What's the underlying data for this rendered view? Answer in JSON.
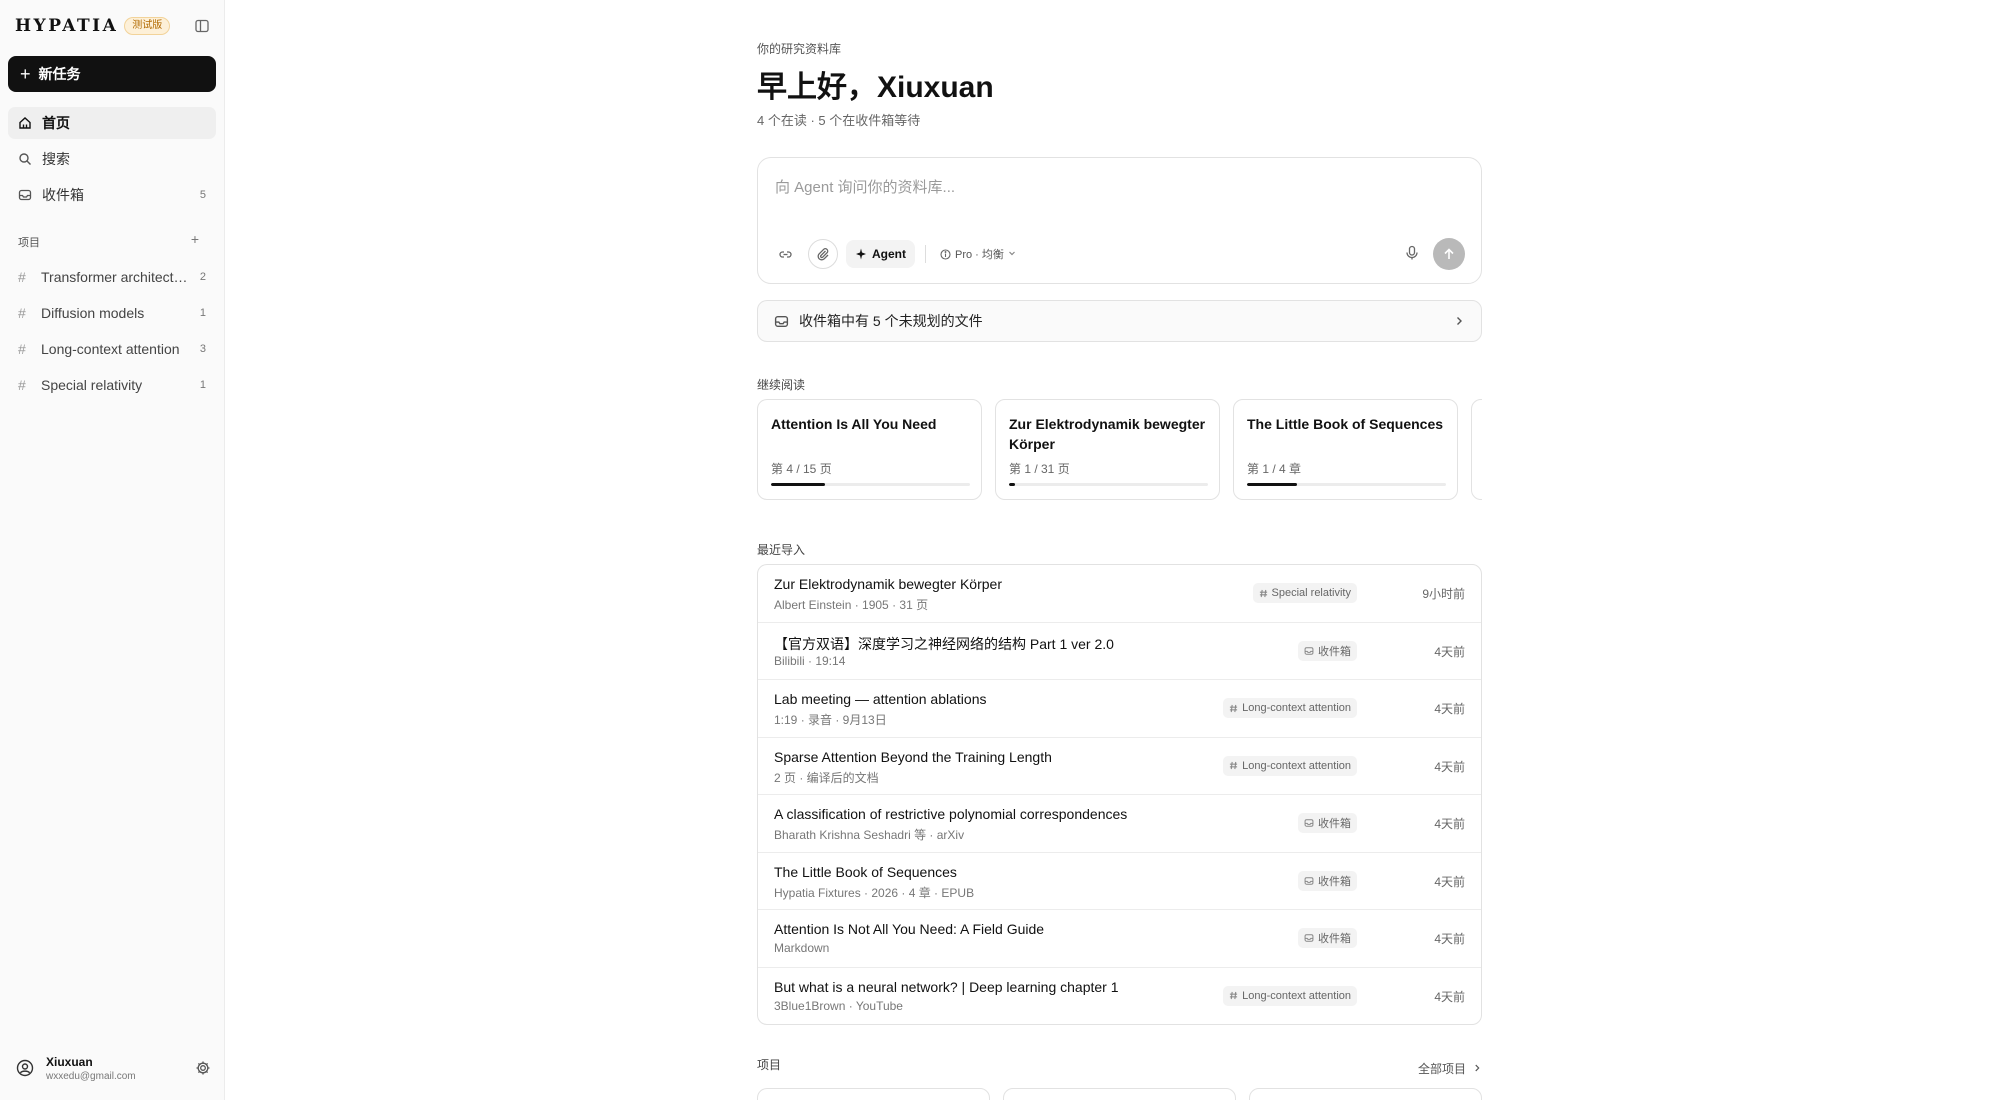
{
  "app": {
    "logo": "HYPATIA",
    "beta_badge": "测试版"
  },
  "sidebar": {
    "new_task_label": "新任务",
    "nav": [
      {
        "label": "首页",
        "icon": "home-icon",
        "active": true
      },
      {
        "label": "搜索",
        "icon": "search-icon"
      },
      {
        "label": "收件箱",
        "icon": "inbox-icon",
        "count": "5"
      }
    ],
    "projects_label": "项目",
    "projects": [
      {
        "name": "Transformer architecture",
        "count": "2"
      },
      {
        "name": "Diffusion models",
        "count": "1"
      },
      {
        "name": "Long-context attention",
        "count": "3"
      },
      {
        "name": "Special relativity",
        "count": "1"
      }
    ],
    "user": {
      "name": "Xiuxuan",
      "email": "wxxedu@gmail.com"
    }
  },
  "main": {
    "kicker": "你的研究资料库",
    "greeting": "早上好，Xiuxuan",
    "substats": "4 个在读 · 5 个在收件箱等待",
    "composer": {
      "placeholder": "向 Agent 询问你的资料库...",
      "agent_label": "Agent",
      "model_label": "Pro · 均衡"
    },
    "inbox_banner": "收件箱中有 5 个未规划的文件",
    "continue_label": "继续阅读",
    "reading": [
      {
        "title": "Attention Is All You Need",
        "progress_text": "第 4 / 15 页",
        "progress": 0.27
      },
      {
        "title": "Zur Elektrodynamik bewegter Körper",
        "progress_text": "第 1 / 31 页",
        "progress": 0.03
      },
      {
        "title": "The Little Book of Sequences",
        "progress_text": "第 1 / 4 章",
        "progress": 0.25
      }
    ],
    "recent_label": "最近导入",
    "recent": [
      {
        "title": "Zur Elektrodynamik bewegter Körper",
        "meta": "Albert Einstein · 1905 · 31 页",
        "tag": "Special relativity",
        "tag_icon": "hash-icon",
        "time": "9小时前"
      },
      {
        "title": "【官方双语】深度学习之神经网络的结构 Part 1 ver 2.0",
        "meta": "Bilibili · 19:14",
        "tag": "收件箱",
        "tag_icon": "inbox-icon",
        "time": "4天前"
      },
      {
        "title": "Lab meeting — attention ablations",
        "meta": "1:19 · 录音 · 9月13日",
        "tag": "Long-context attention",
        "tag_icon": "hash-icon",
        "time": "4天前"
      },
      {
        "title": "Sparse Attention Beyond the Training Length",
        "meta": "2 页 · 编译后的文档",
        "tag": "Long-context attention",
        "tag_icon": "hash-icon",
        "time": "4天前"
      },
      {
        "title": "A classification of restrictive polynomial correspondences",
        "meta": "Bharath Krishna Seshadri 等 · arXiv",
        "tag": "收件箱",
        "tag_icon": "inbox-icon",
        "time": "4天前"
      },
      {
        "title": "The Little Book of Sequences",
        "meta": "Hypatia Fixtures · 2026 · 4 章 · EPUB",
        "tag": "收件箱",
        "tag_icon": "inbox-icon",
        "time": "4天前"
      },
      {
        "title": "Attention Is Not All You Need: A Field Guide",
        "meta": "Markdown",
        "tag": "收件箱",
        "tag_icon": "inbox-icon",
        "time": "4天前"
      },
      {
        "title": "But what is a neural network? | Deep learning chapter 1",
        "meta": "3Blue1Brown · YouTube",
        "tag": "Long-context attention",
        "tag_icon": "hash-icon",
        "time": "4天前"
      }
    ],
    "projects_label": "项目",
    "all_projects_label": "全部项目"
  },
  "colors": {
    "primary": "#111111",
    "sidebar_bg": "#fafafa",
    "beta_text": "#b26a00",
    "beta_bg": "#fdf0d8"
  }
}
